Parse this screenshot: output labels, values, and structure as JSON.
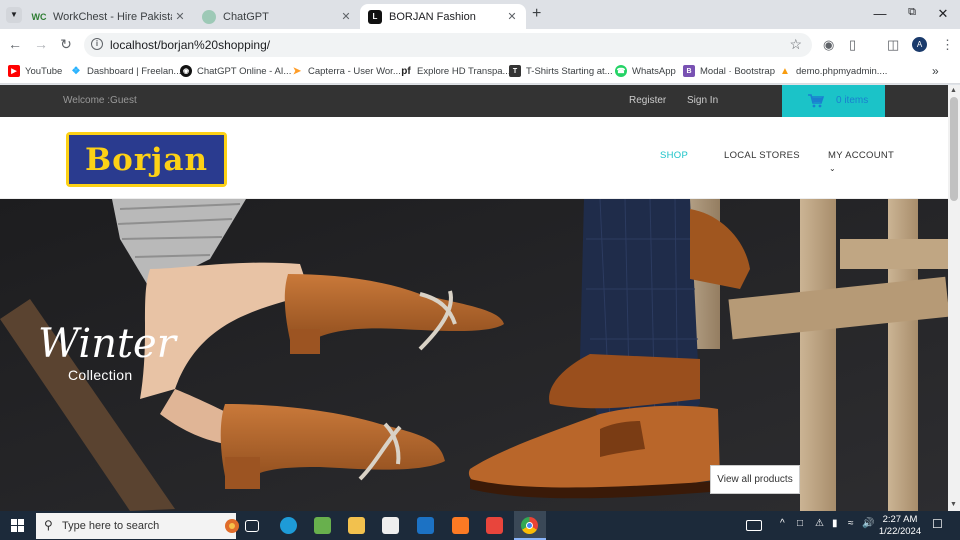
{
  "browser": {
    "tabs": [
      {
        "title": "WorkChest - Hire Pakistani Free",
        "active": false,
        "favicon": "workchest-icon"
      },
      {
        "title": "ChatGPT",
        "active": false,
        "favicon": "chatgpt-icon"
      },
      {
        "title": "BORJAN Fashion",
        "active": true,
        "favicon": "borjan-icon"
      }
    ],
    "new_tab": "+",
    "url": "localhost/borjan%20shopping/",
    "profile_initial": "A",
    "bookmarks": [
      {
        "label": "YouTube",
        "icon": "youtube-icon",
        "color": "#ff0000"
      },
      {
        "label": "Dashboard | Freelan...",
        "icon": "freelancer-icon",
        "color": "#29b2fe"
      },
      {
        "label": "ChatGPT Online - AI...",
        "icon": "chatgpt-icon",
        "color": "#111111"
      },
      {
        "label": "Capterra - User Wor...",
        "icon": "capterra-icon",
        "color": "#ff9d28"
      },
      {
        "label": "Explore HD Transpa...",
        "icon": "pngfind-icon",
        "color": "#222222"
      },
      {
        "label": "T-Shirts Starting at...",
        "icon": "tshirt-icon",
        "color": "#333333"
      },
      {
        "label": "WhatsApp",
        "icon": "whatsapp-icon",
        "color": "#25d366"
      },
      {
        "label": "Modal · Bootstrap",
        "icon": "bootstrap-icon",
        "color": "#7952b3"
      },
      {
        "label": "demo.phpmyadmin....",
        "icon": "phpmyadmin-icon",
        "color": "#f89c0e"
      }
    ]
  },
  "site": {
    "topbar": {
      "welcome": "Welcome :Guest",
      "register": "Register",
      "signin": "Sign In",
      "cart": "0 items"
    },
    "logo_text": "Borjan",
    "nav": [
      {
        "label": "SHOP",
        "active": true
      },
      {
        "label": "LOCAL STORES",
        "active": false
      },
      {
        "label": "MY ACCOUNT",
        "active": false
      }
    ],
    "hero": {
      "headline": "Winter",
      "subline": "Collection",
      "cta": "View all products"
    }
  },
  "taskbar": {
    "search_placeholder": "Type here to search",
    "time": "2:27 AM",
    "date": "1/22/2024"
  },
  "colors": {
    "accent": "#1bc3c8",
    "logo_blue": "#2a3b8f",
    "logo_yellow": "#fcd116",
    "topbar": "#333333"
  }
}
